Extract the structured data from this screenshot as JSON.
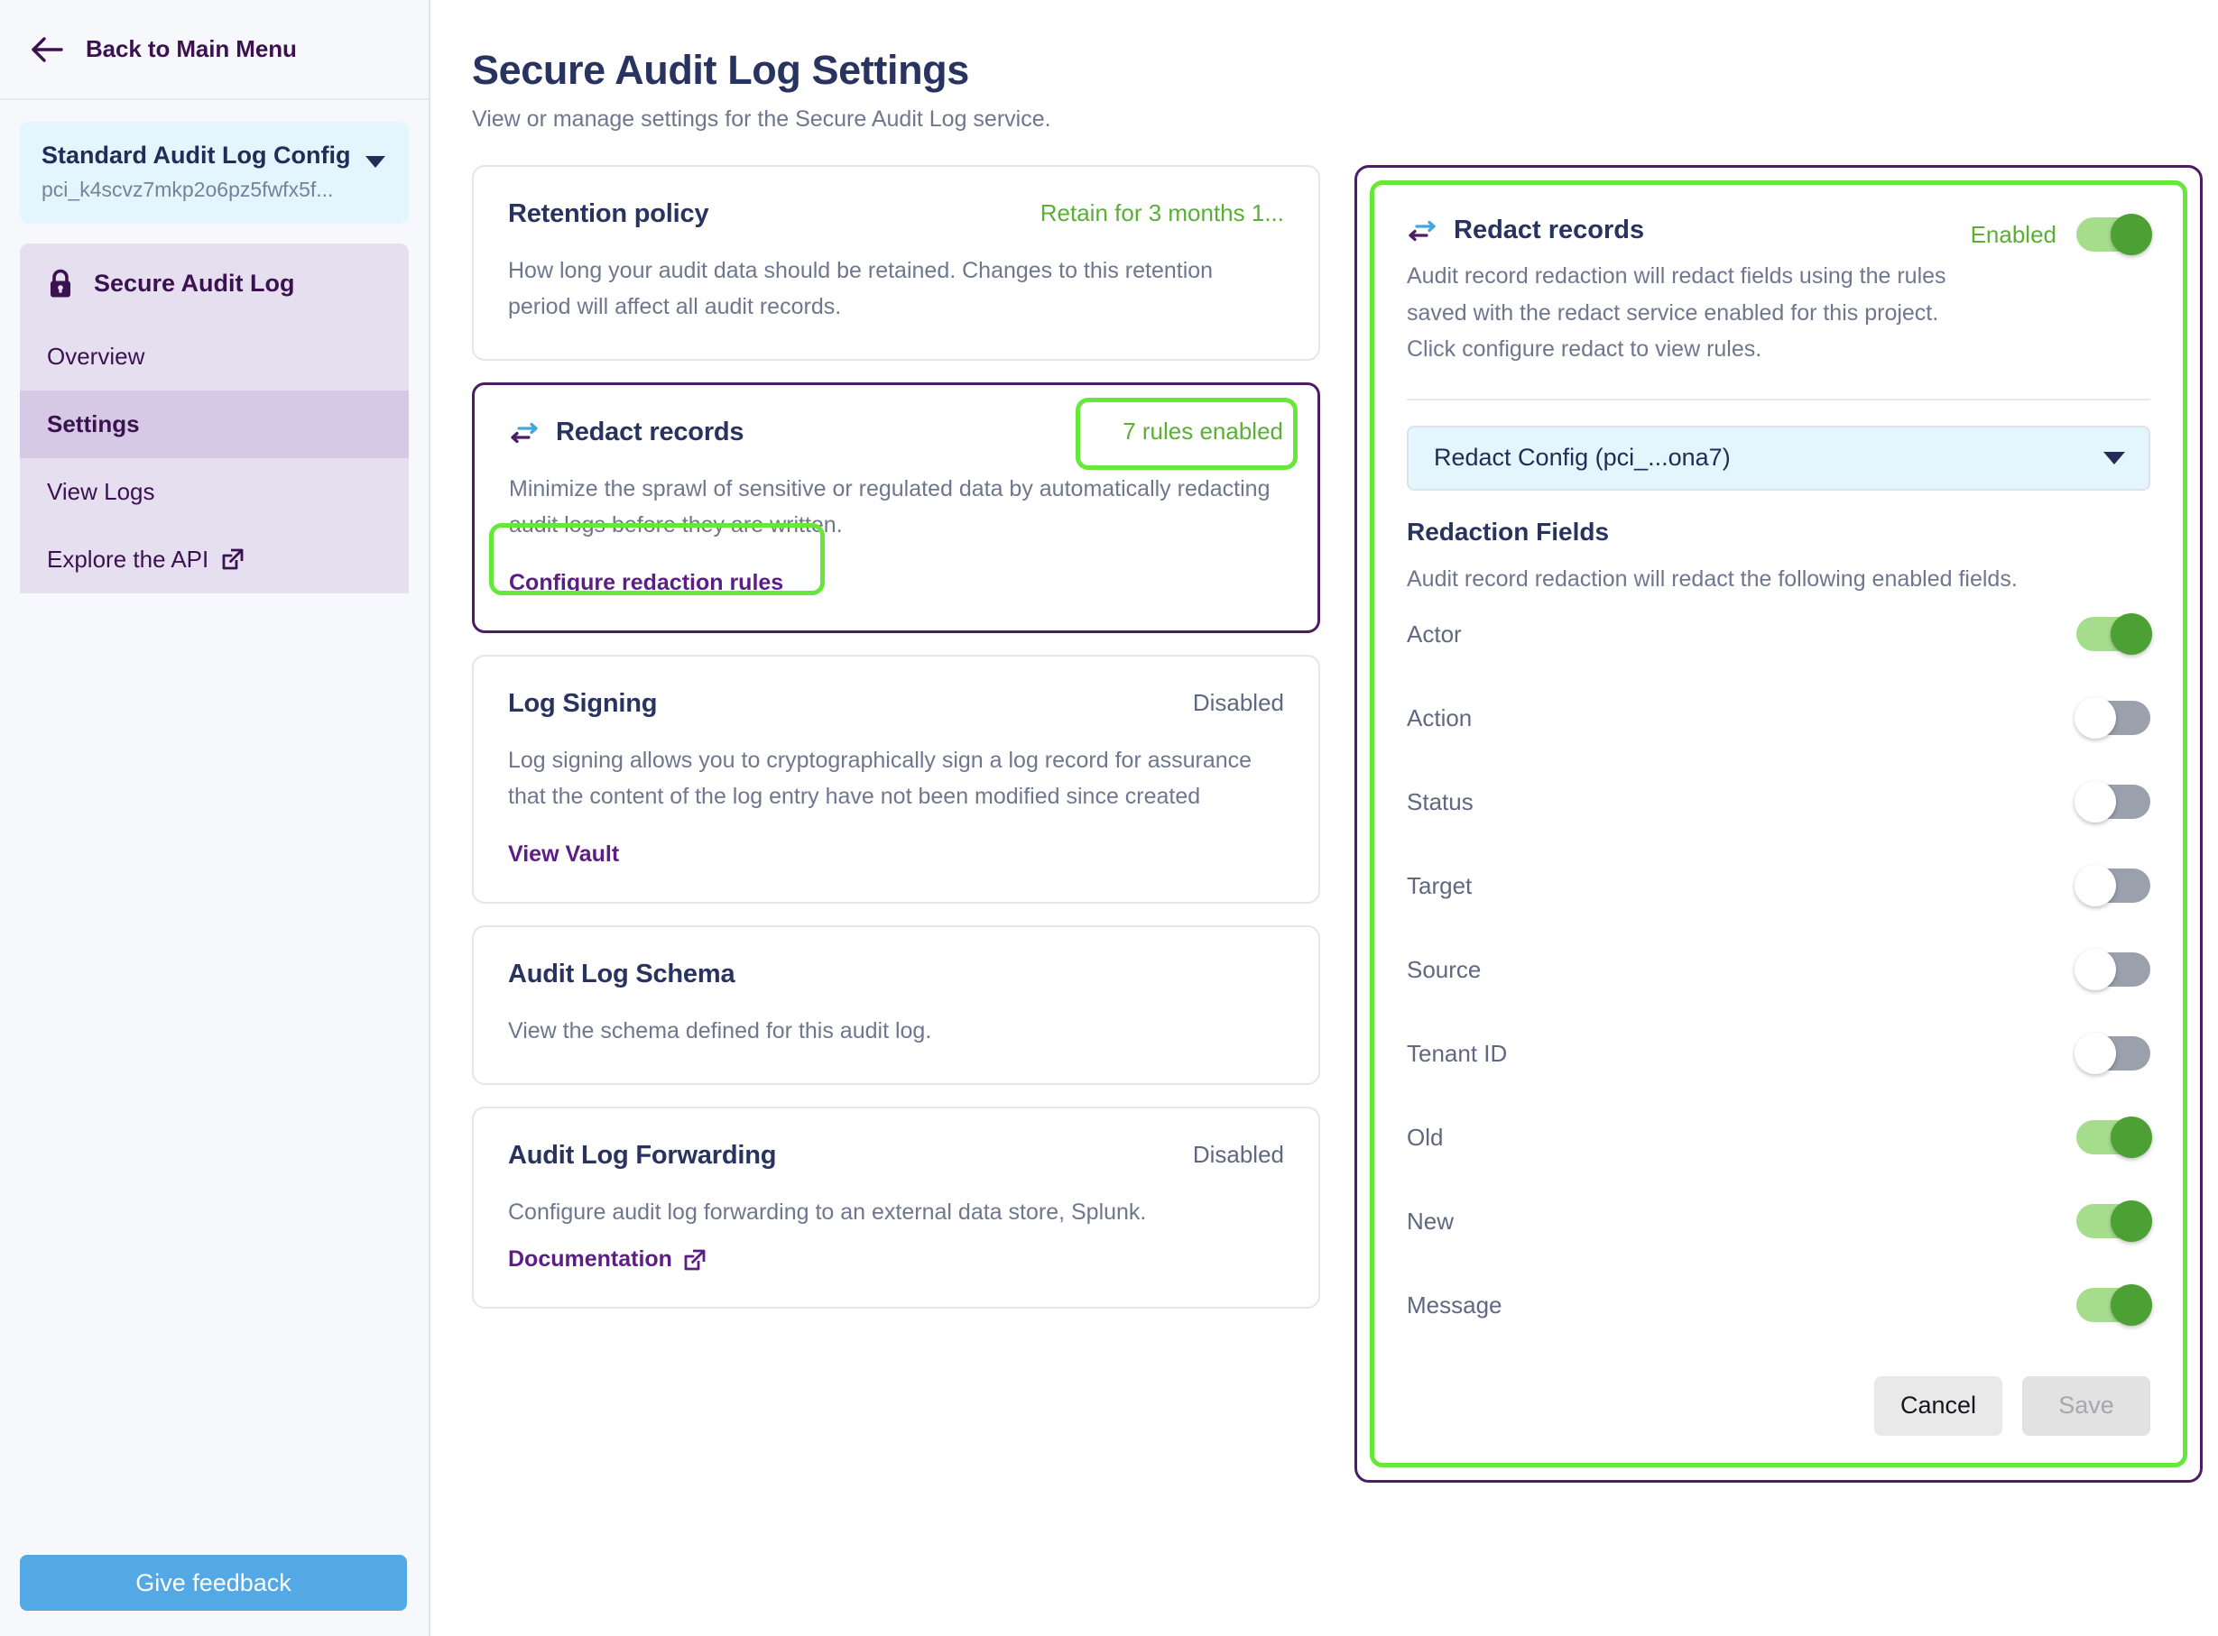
{
  "sidebar": {
    "back_label": "Back to Main Menu",
    "back_icon": "arrow-left-icon",
    "config": {
      "name": "Standard Audit Log Config",
      "id": "pci_k4scvz7mkp2o6pz5fwfx5f...",
      "caret_icon": "chevron-down-icon"
    },
    "section_label": "Secure Audit Log",
    "section_icon": "lock-icon",
    "items": [
      {
        "label": "Overview",
        "active": false
      },
      {
        "label": "Settings",
        "active": true
      },
      {
        "label": "View Logs",
        "active": false
      },
      {
        "label": "Explore the API",
        "active": false,
        "icon": "external-link-icon"
      }
    ],
    "feedback_label": "Give feedback"
  },
  "header": {
    "title": "Secure Audit Log Settings",
    "subtitle": "View or manage settings for the Secure Audit Log service."
  },
  "cards": {
    "retention": {
      "title": "Retention policy",
      "status": "Retain for 3 months 1...",
      "body": "How long your audit data should be retained. Changes to this retention period will affect all audit records."
    },
    "redact": {
      "icon": "redact-exchange-icon",
      "title": "Redact records",
      "status": "7 rules enabled",
      "body": "Minimize the sprawl of sensitive or regulated data by automatically redacting audit logs before they are written.",
      "link": "Configure redaction rules"
    },
    "log_signing": {
      "title": "Log Signing",
      "status": "Disabled",
      "body": "Log signing allows you to cryptographically sign a log record for assurance that the content of the log entry have not been modified since created",
      "link": "View Vault"
    },
    "schema": {
      "title": "Audit Log Schema",
      "body": "View the schema defined for this audit log."
    },
    "forwarding": {
      "title": "Audit Log Forwarding",
      "status": "Disabled",
      "body": "Configure audit log forwarding to an external data store, Splunk.",
      "link": "Documentation",
      "link_icon": "external-link-icon"
    }
  },
  "panel": {
    "icon": "redact-exchange-icon",
    "title": "Redact records",
    "toggle_label": "Enabled",
    "toggle_on": true,
    "description": "Audit record redaction will redact fields using the rules saved with the redact service enabled for this project. Click configure redact to view rules.",
    "select": {
      "value": "Redact Config (pci_...ona7)",
      "caret_icon": "chevron-down-icon"
    },
    "fields_title": "Redaction Fields",
    "fields_desc": "Audit record redaction will redact the following enabled fields.",
    "fields": [
      {
        "label": "Actor",
        "on": true
      },
      {
        "label": "Action",
        "on": false
      },
      {
        "label": "Status",
        "on": false
      },
      {
        "label": "Target",
        "on": false
      },
      {
        "label": "Source",
        "on": false
      },
      {
        "label": "Tenant ID",
        "on": false
      },
      {
        "label": "Old",
        "on": true
      },
      {
        "label": "New",
        "on": true
      },
      {
        "label": "Message",
        "on": true
      }
    ],
    "cancel_label": "Cancel",
    "save_label": "Save"
  },
  "colors": {
    "accent_purple": "#4d1c66",
    "highlight_green": "#66e83a",
    "status_green": "#5aaf35",
    "title_navy": "#29335f",
    "feedback_blue": "#54a8e3"
  }
}
